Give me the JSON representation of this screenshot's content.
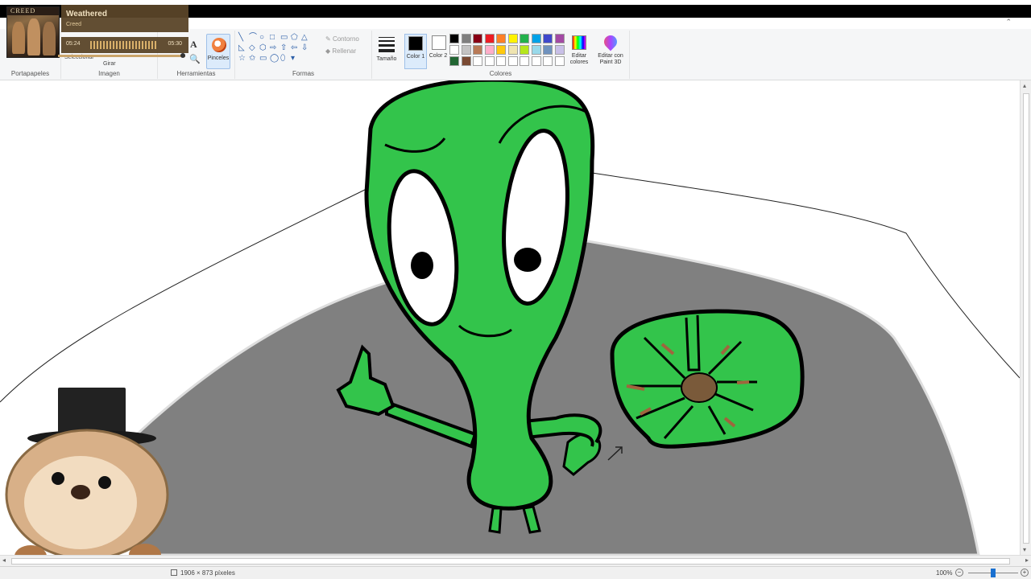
{
  "music_widget": {
    "album_label": "CREED",
    "song_title": "Weathered",
    "artist": "Creed",
    "elapsed": "05:24",
    "duration": "05:30",
    "progress": 0.98
  },
  "ribbon": {
    "groups": {
      "clipboard": "Portapapeles",
      "image": "Imagen",
      "tools": "Herramientas",
      "shapes": "Formas",
      "colors": "Colores"
    },
    "image_buttons": {
      "select": "Seleccionar",
      "rotate": "Girar"
    },
    "brushes_label": "Pinceles",
    "outline_label": "Contorno",
    "fill_label": "Rellenar",
    "size_label": "Tamaño",
    "color1_label": "Color 1",
    "color2_label": "Color 2",
    "edit_colors_label": "Editar colores",
    "paint3d_label": "Editar con Paint 3D",
    "help": "?",
    "collapse": "⌃",
    "text_tool": "A",
    "zoom_tool": "🔍",
    "shape_glyphs": [
      "╲",
      "⌒",
      "○",
      "□",
      "▭",
      "⬠",
      "△",
      "◺",
      "◇",
      "⬡",
      "⇨",
      "⇧",
      "⇦",
      "⇩",
      "☆",
      "✩",
      "▭",
      "◯",
      "⬯",
      "▾"
    ],
    "color1_value": "#000000",
    "color2_value": "#ffffff",
    "palette_row1": [
      "#000000",
      "#7f7f7f",
      "#880015",
      "#ed1c24",
      "#ff7f27",
      "#fff200",
      "#22b14c",
      "#00a2e8",
      "#3f48cc",
      "#a349a4"
    ],
    "palette_row2": [
      "#ffffff",
      "#c3c3c3",
      "#b97a57",
      "#ffaec9",
      "#ffc90e",
      "#efe4b0",
      "#b5e61d",
      "#99d9ea",
      "#7092be",
      "#c8bfe7"
    ],
    "palette_row3": [
      "#226633",
      "#7a4a33",
      "#ffffff",
      "#ffffff",
      "#ffffff",
      "#ffffff",
      "#ffffff",
      "#ffffff",
      "#ffffff",
      "#ffffff"
    ]
  },
  "status": {
    "dimensions": "1906 × 873 píxeles",
    "zoom": "100%",
    "zoom_minus": "−",
    "zoom_plus": "+",
    "zoom_level": 0.5
  },
  "scroll": {
    "left": "◂",
    "right": "▸",
    "up": "▴",
    "down": "▾"
  },
  "colors": {
    "alien_green": "#33c44b",
    "table_gray": "#808080",
    "outline": "#000000",
    "ribbon_bg": "#f5f6f7",
    "accent": "#1a70d0"
  }
}
